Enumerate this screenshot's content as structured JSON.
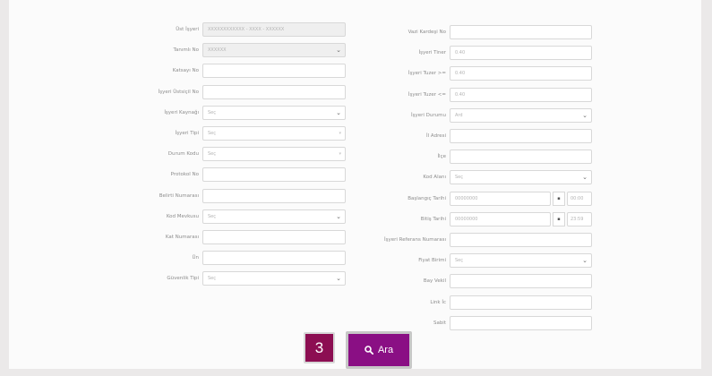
{
  "form": {
    "left": [
      {
        "label": "Üst İşyeri",
        "value": "XXXXXXXXXXXX - XXXX - XXXXXX",
        "kind": "text",
        "disabled": true
      },
      {
        "label": "Tanımlı No",
        "value": "XXXXXX",
        "kind": "select",
        "disabled": true
      },
      {
        "label": "Katsayı No",
        "value": "",
        "kind": "text"
      },
      {
        "label": "İşyeri Üstsiçil No",
        "value": "",
        "kind": "text"
      },
      {
        "label": "İşyeri Kaynağı",
        "value": "Seç",
        "kind": "select"
      },
      {
        "label": "İşyeri Tipi",
        "value": "Seç",
        "kind": "select-light"
      },
      {
        "label": "Durum Kodu",
        "value": "Seç",
        "kind": "select-light"
      },
      {
        "label": "Protokol No",
        "value": "",
        "kind": "text"
      },
      {
        "label": "Belirti Numarası",
        "value": "",
        "kind": "text"
      },
      {
        "label": "Kod Mevkusu",
        "value": "Seç",
        "kind": "select"
      },
      {
        "label": "Kat Numarası",
        "value": "",
        "kind": "text"
      },
      {
        "label": "Ün",
        "value": "",
        "kind": "text"
      },
      {
        "label": "Güvenlik Tipi",
        "value": "Seç",
        "kind": "select"
      }
    ],
    "right": [
      {
        "label": "Vazi Kardeşi No",
        "value": "",
        "kind": "text"
      },
      {
        "label": "İşyeri Tiner",
        "value": "0.40",
        "kind": "text"
      },
      {
        "label": "İşyeri Tuzer >=",
        "value": "0.40",
        "kind": "text"
      },
      {
        "label": "İşyeri Tuzer <=",
        "value": "0.40",
        "kind": "text"
      },
      {
        "label": "İşyeri Durumu",
        "value": "Ard",
        "kind": "select"
      },
      {
        "label": "İl Adresi",
        "value": "",
        "kind": "text"
      },
      {
        "label": "İlçe",
        "value": "",
        "kind": "text"
      },
      {
        "label": "Kod Alanı",
        "value": "Seç",
        "kind": "select"
      },
      {
        "label": "Başlangıç Tarihi",
        "value": "00000000",
        "kind": "date",
        "time": "00:00"
      },
      {
        "label": "Bitiş Tarihi",
        "value": "00000000",
        "kind": "date",
        "time": "23:59"
      },
      {
        "label": "İşyeri Referans Numarası",
        "value": "",
        "kind": "text"
      },
      {
        "label": "Fiyat Birimi",
        "value": "Seç",
        "kind": "select"
      },
      {
        "label": "Bay Vekil",
        "value": "",
        "kind": "text"
      },
      {
        "label": "Link İc",
        "value": "",
        "kind": "text"
      },
      {
        "label": "Sabit",
        "value": "",
        "kind": "text"
      }
    ]
  },
  "step_number": "3",
  "search_button": {
    "label": "Ara",
    "icon": "search-icon"
  },
  "colors": {
    "badge": "#8c0e52",
    "button": "#8a0f84",
    "page_bg": "#ebe9e9",
    "panel_bg": "#fbfbfb"
  }
}
